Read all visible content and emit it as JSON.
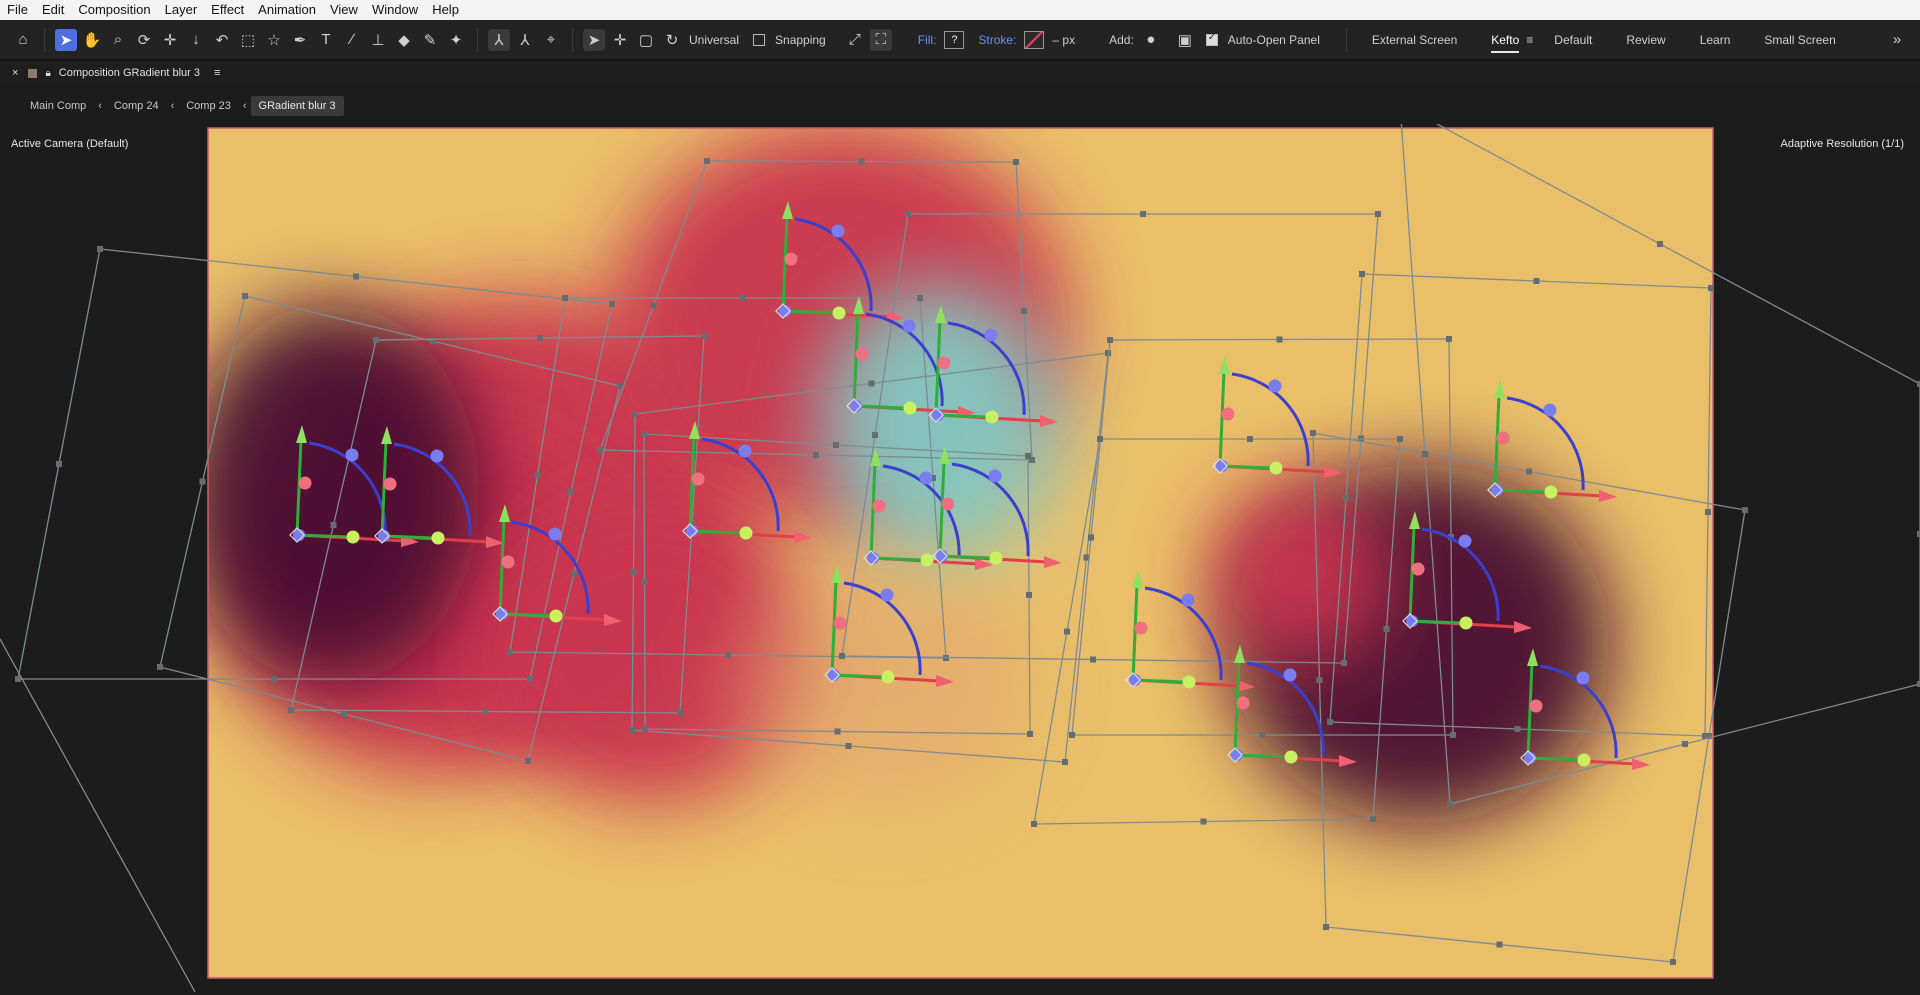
{
  "menu": [
    "File",
    "Edit",
    "Composition",
    "Layer",
    "Effect",
    "Animation",
    "View",
    "Window",
    "Help"
  ],
  "toolbar": {
    "tool_icons": [
      "home-icon",
      "selection-icon",
      "hand-icon",
      "zoom-icon",
      "orbit-icon",
      "pan-icon",
      "dolly-icon",
      "rotate-icon",
      "pan-behind-icon",
      "shape-icon",
      "pen-icon",
      "type-icon",
      "brush-icon",
      "clone-stamp-icon",
      "eraser-icon",
      "roto-brush-icon",
      "puppet-pin-icon"
    ],
    "universal_label": "Universal",
    "snapping_label": "Snapping",
    "fill_label": "Fill:",
    "fill_value": "?",
    "stroke_label": "Stroke:",
    "stroke_value": "– px",
    "add_label": "Add:",
    "auto_open_label": "Auto-Open Panel",
    "auto_open_checked": true
  },
  "workspaces": [
    {
      "label": "External Screen",
      "active": false
    },
    {
      "label": "Kefto",
      "active": true
    },
    {
      "label": "Default",
      "active": false
    },
    {
      "label": "Review",
      "active": false
    },
    {
      "label": "Learn",
      "active": false
    },
    {
      "label": "Small Screen",
      "active": false
    }
  ],
  "panel": {
    "title": "Composition GRadient blur 3"
  },
  "breadcrumbs": [
    "Main Comp",
    "Comp 24",
    "Comp 23",
    "GRadient blur 3"
  ],
  "viewer": {
    "camera_label": "Active Camera (Default)",
    "resolution_label": "Adaptive Resolution (1/1)",
    "colors": {
      "bg": "#e9bf6a",
      "red": "#c9354f",
      "dark": "#4a1030",
      "cyan": "#7fd0c8"
    }
  }
}
